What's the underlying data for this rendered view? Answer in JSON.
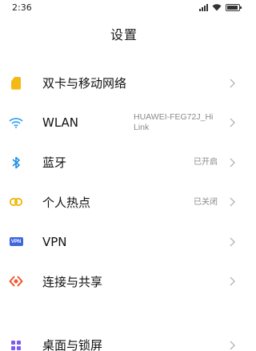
{
  "status_bar": {
    "time": "2:36"
  },
  "page": {
    "title": "设置"
  },
  "rows": [
    {
      "label": "双卡与移动网络",
      "value": "",
      "icon": "sim-card-icon"
    },
    {
      "label": "WLAN",
      "value": "HUAWEI-FEG72J_HiLink",
      "icon": "wifi-icon"
    },
    {
      "label": "蓝牙",
      "value": "已开启",
      "icon": "bluetooth-icon"
    },
    {
      "label": "个人热点",
      "value": "已关闭",
      "icon": "hotspot-icon"
    },
    {
      "label": "VPN",
      "value": "",
      "icon": "vpn-icon",
      "badge_text": "VPN"
    },
    {
      "label": "连接与共享",
      "value": "",
      "icon": "share-icon"
    }
  ],
  "bottom_rows": [
    {
      "label": "桌面与锁屏",
      "icon": "desktop-icon"
    }
  ],
  "colors": {
    "sim": "#f5b914",
    "wifi": "#2a9df4",
    "bluetooth": "#1e8fe6",
    "hotspot": "#f0b400",
    "vpn": "#3f66e0",
    "share": "#f0552a",
    "chevron": "#b5b5b5"
  }
}
